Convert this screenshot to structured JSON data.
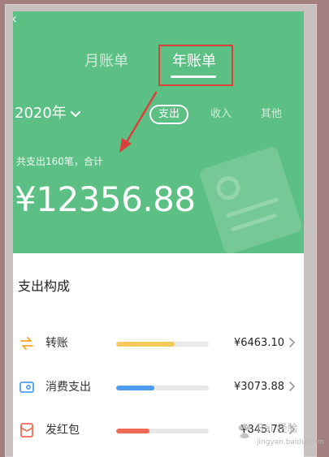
{
  "header": {
    "tabs": [
      {
        "label": "月账单",
        "active": false
      },
      {
        "label": "年账单",
        "active": true
      }
    ]
  },
  "filter": {
    "year": "2020年",
    "types": [
      {
        "label": "支出",
        "active": true
      },
      {
        "label": "收入",
        "active": false
      },
      {
        "label": "其他",
        "active": false
      }
    ]
  },
  "summary": {
    "line": "共支出160笔，合计",
    "total": "¥12356.88"
  },
  "breakdown": {
    "title": "支出构成",
    "items": [
      {
        "label": "转账",
        "amount": "¥6463.10",
        "ratio": 0.63,
        "color": "#f7c85e",
        "icon": "transfer-icon"
      },
      {
        "label": "消费支出",
        "amount": "¥3073.88",
        "ratio": 0.41,
        "color": "#4c9cf0",
        "icon": "wallet-icon"
      },
      {
        "label": "发红包",
        "amount": "¥845.78",
        "ratio": 0.36,
        "color": "#f06a55",
        "icon": "red-packet-icon"
      }
    ]
  },
  "watermark": {
    "text": "Bai 经验",
    "sub": "jingyan.baidu.com"
  },
  "colors": {
    "hero": "#5cbf84",
    "annotation": "#d9403b"
  }
}
